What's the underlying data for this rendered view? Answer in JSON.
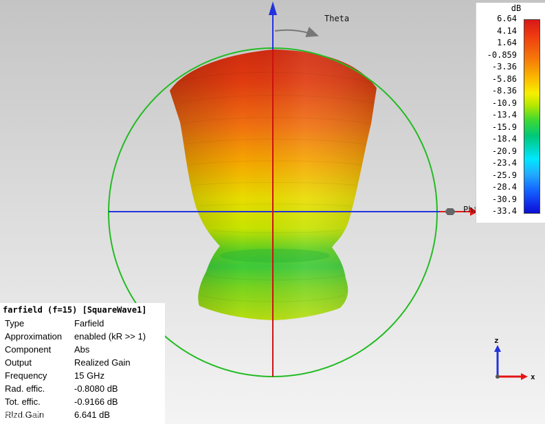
{
  "viewport": {
    "theta_label": "Theta",
    "phi_label": "Phi"
  },
  "colors": {
    "circle": "#22bb22",
    "z_axis": "#cc1111",
    "x_axis": "#2233dd",
    "phi_axis": "#e41414"
  },
  "scale": {
    "unit": "dB",
    "ticks": [
      "6.64",
      "4.14",
      "1.64",
      "-0.859",
      "-3.36",
      "-5.86",
      "-8.36",
      "-10.9",
      "-13.4",
      "-15.9",
      "-18.4",
      "-20.9",
      "-23.4",
      "-25.9",
      "-28.4",
      "-30.9",
      "-33.4"
    ]
  },
  "info": {
    "title": "farfield (f=15) [SquareWave1]",
    "rows": [
      {
        "key": "Type",
        "value": "Farfield"
      },
      {
        "key": "Approximation",
        "value": "enabled (kR >> 1)"
      },
      {
        "key": "Component",
        "value": "Abs"
      },
      {
        "key": "Output",
        "value": "Realized Gain"
      },
      {
        "key": "Frequency",
        "value": "15 GHz"
      },
      {
        "key": "Rad. effic.",
        "value": "-0.8080 dB"
      },
      {
        "key": "Tot. effic.",
        "value": "-0.9166 dB"
      },
      {
        "key": "Rlzd.Gain",
        "value": "6.641 dB"
      }
    ]
  },
  "watermark": "电磁计算跨境",
  "triad": {
    "z": "z",
    "x": "x"
  }
}
